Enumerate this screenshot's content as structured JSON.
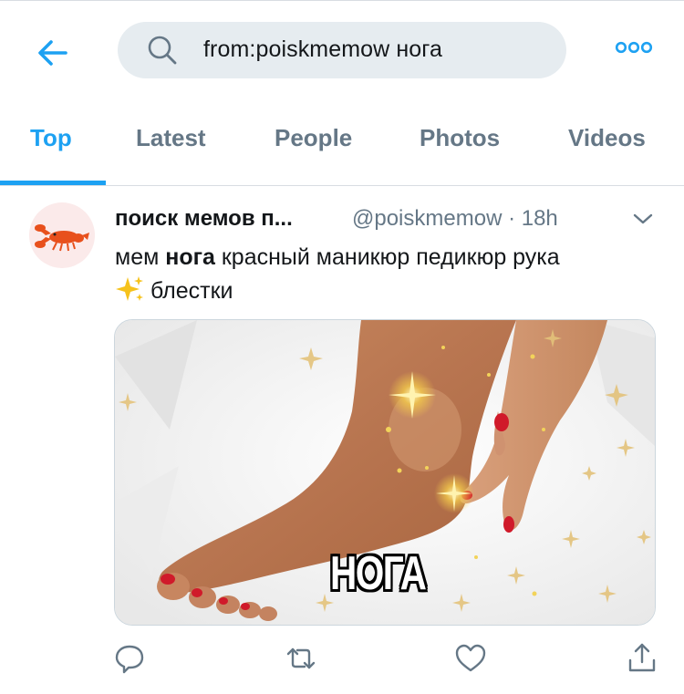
{
  "header": {
    "back_icon": "back-arrow-icon",
    "search_icon": "search-icon",
    "search_query": "from:poiskmemow нога",
    "more_icon": "more-dots-icon",
    "accent_color": "#1da1f2"
  },
  "tabs": [
    {
      "label": "Top",
      "active": true
    },
    {
      "label": "Latest",
      "active": false
    },
    {
      "label": "People",
      "active": false
    },
    {
      "label": "Photos",
      "active": false
    },
    {
      "label": "Videos",
      "active": false
    }
  ],
  "tweet": {
    "author_name": "поиск мемов п...",
    "author_handle": "@poiskmemow · 18h",
    "text_before": "мем ",
    "text_bold": "нога",
    "text_after": " красный маникюр педикюр рука",
    "text_line2": "блестки",
    "emoji": "sparkles",
    "media_caption": "НОГА",
    "actions": [
      "reply-icon",
      "retweet-icon",
      "like-icon",
      "share-icon"
    ]
  }
}
